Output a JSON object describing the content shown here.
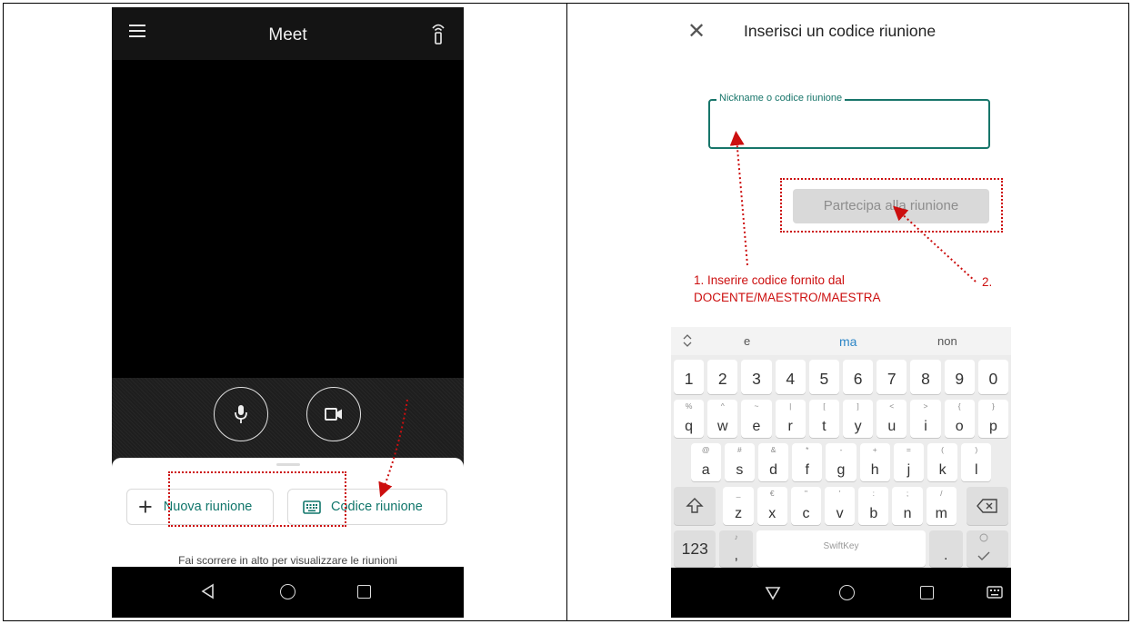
{
  "left_screen": {
    "app_title": "Meet",
    "new_meeting_label": "Nuova riunione",
    "meeting_code_label": "Codice riunione",
    "swipe_hint": "Fai scorrere in alto per visualizzare le riunioni"
  },
  "right_screen": {
    "header_title": "Inserisci un codice riunione",
    "close_symbol": "✕",
    "field_label": "Nickname o codice riunione",
    "field_value": "",
    "join_button_label": "Partecipa alla riunione",
    "annotation_1_line1": "1. Inserire codice fornito dal",
    "annotation_1_line2": "DOCENTE/MAESTRO/MAESTRA",
    "annotation_2": "2.",
    "keyboard": {
      "suggestions": [
        "e",
        "ma",
        "non"
      ],
      "number_row": [
        "1",
        "2",
        "3",
        "4",
        "5",
        "6",
        "7",
        "8",
        "9",
        "0"
      ],
      "row1": [
        {
          "k": "q",
          "s": "%"
        },
        {
          "k": "w",
          "s": "^"
        },
        {
          "k": "e",
          "s": "~"
        },
        {
          "k": "r",
          "s": "|"
        },
        {
          "k": "t",
          "s": "["
        },
        {
          "k": "y",
          "s": "]"
        },
        {
          "k": "u",
          "s": "<"
        },
        {
          "k": "i",
          "s": ">"
        },
        {
          "k": "o",
          "s": "{"
        },
        {
          "k": "p",
          "s": "}"
        }
      ],
      "row2": [
        {
          "k": "a",
          "s": "@"
        },
        {
          "k": "s",
          "s": "#"
        },
        {
          "k": "d",
          "s": "&"
        },
        {
          "k": "f",
          "s": "*"
        },
        {
          "k": "g",
          "s": "-"
        },
        {
          "k": "h",
          "s": "+"
        },
        {
          "k": "j",
          "s": "="
        },
        {
          "k": "k",
          "s": "("
        },
        {
          "k": "l",
          "s": ")"
        }
      ],
      "row3": [
        {
          "k": "z",
          "s": "_"
        },
        {
          "k": "x",
          "s": "€"
        },
        {
          "k": "c",
          "s": "\""
        },
        {
          "k": "v",
          "s": "'"
        },
        {
          "k": "b",
          "s": ":"
        },
        {
          "k": "n",
          "s": ";"
        },
        {
          "k": "m",
          "s": "/"
        }
      ],
      "symbols_key": "123",
      "comma_key": ",",
      "period_key": ".",
      "space_brand": "SwiftKey"
    }
  },
  "colors": {
    "teal": "#11766b",
    "annotation_red": "#cc0f0f",
    "suggestion_blue": "#2c86c7"
  },
  "icons": [
    "menu-icon",
    "audio-output-icon",
    "microphone-icon",
    "camera-icon",
    "plus-icon",
    "keyboard-icon",
    "back-icon",
    "home-icon",
    "recent-apps-icon",
    "shift-icon",
    "backspace-icon",
    "mic-small-icon",
    "emoji-icon",
    "keyboard-hide-icon",
    "close-icon"
  ]
}
